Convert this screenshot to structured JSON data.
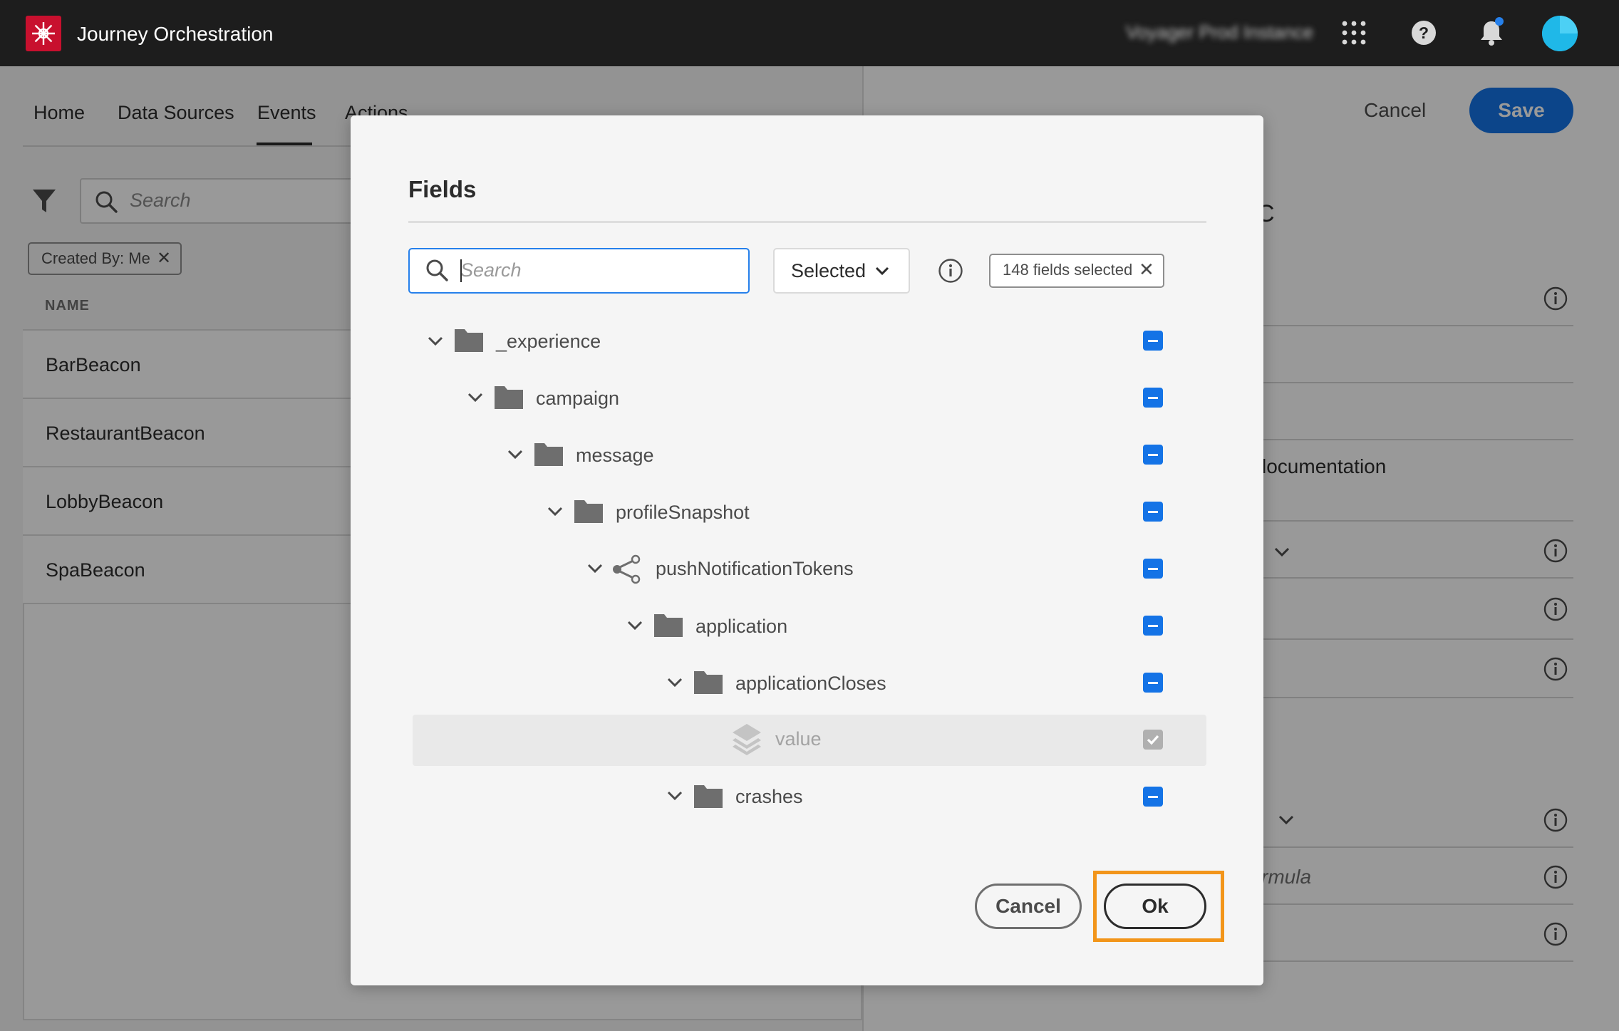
{
  "header": {
    "app_title": "Journey Orchestration",
    "instance_name": "Voyager Prod Instance",
    "brand_color": "#c8102e",
    "icons": [
      "app-grid-icon",
      "help-icon",
      "notification-bell-icon",
      "user-avatar"
    ]
  },
  "nav": {
    "tabs": [
      "Home",
      "Data Sources",
      "Events",
      "Actions"
    ],
    "active_tab": "Events"
  },
  "list": {
    "search_placeholder": "Search",
    "filter_chip": "Created By: Me",
    "column_header": "NAME",
    "rows": [
      "BarBeacon",
      "RestaurantBeacon",
      "LobbyBeacon",
      "SpaBeacon"
    ]
  },
  "right_panel": {
    "cancel_label": "Cancel",
    "save_label": "Save",
    "fragments": [
      "C",
      "locumentation",
      "rmula"
    ]
  },
  "dialog": {
    "title": "Fields",
    "search_placeholder": "Search",
    "filter_value": "Selected",
    "selected_count_label": "148 fields selected",
    "tree": [
      {
        "label": "_experience",
        "type": "folder",
        "state": "partial"
      },
      {
        "label": "campaign",
        "type": "folder",
        "state": "partial"
      },
      {
        "label": "message",
        "type": "folder",
        "state": "partial"
      },
      {
        "label": "profileSnapshot",
        "type": "folder",
        "state": "partial"
      },
      {
        "label": "pushNotificationTokens",
        "type": "array",
        "state": "partial"
      },
      {
        "label": "application",
        "type": "folder",
        "state": "partial"
      },
      {
        "label": "applicationCloses",
        "type": "folder",
        "state": "partial"
      },
      {
        "label": "value",
        "type": "field",
        "state": "checked-disabled"
      },
      {
        "label": "crashes",
        "type": "folder",
        "state": "partial"
      }
    ],
    "cancel_label": "Cancel",
    "ok_label": "Ok",
    "accent_color": "#1473e6",
    "highlight_color": "#f2951a"
  }
}
